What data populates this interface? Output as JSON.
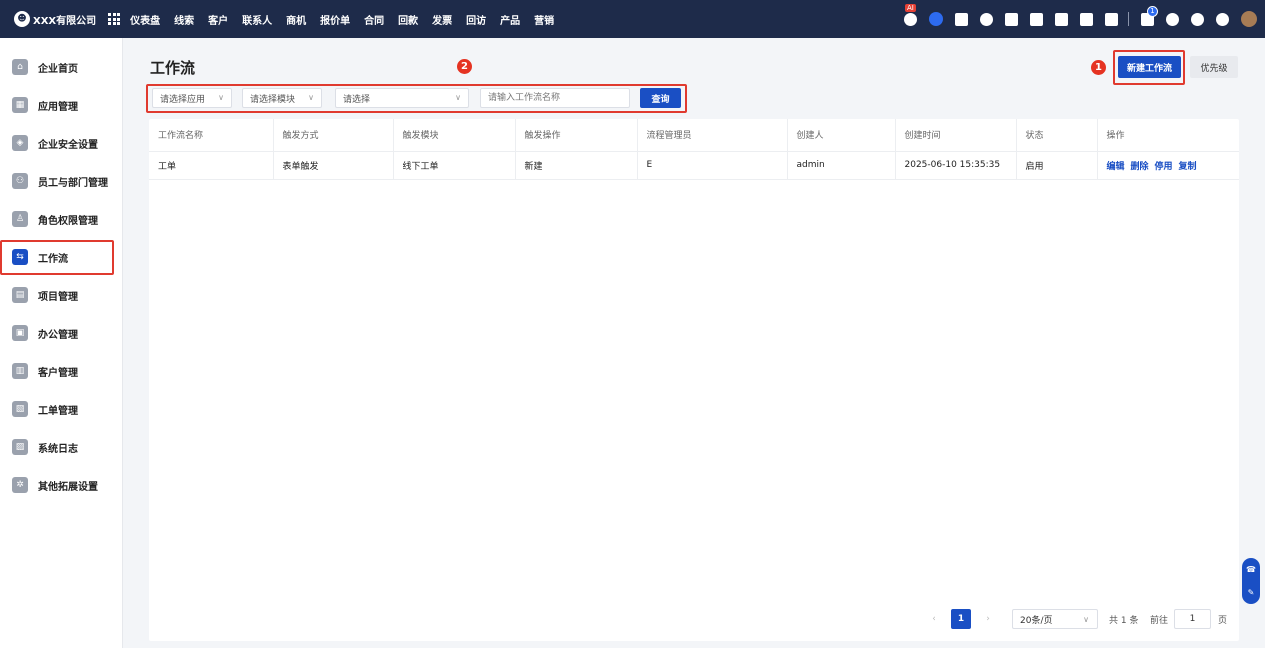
{
  "topbar": {
    "company": "XXX有限公司",
    "nav": [
      "仪表盘",
      "线索",
      "客户",
      "联系人",
      "商机",
      "报价单",
      "合同",
      "回款",
      "发票",
      "回访",
      "产品",
      "营销"
    ],
    "ai_badge": "AI",
    "notification_count": "1"
  },
  "sidebar": {
    "items": [
      {
        "label": "企业首页",
        "icon": "home-icon"
      },
      {
        "label": "应用管理",
        "icon": "apps-icon"
      },
      {
        "label": "企业安全设置",
        "icon": "shield-icon"
      },
      {
        "label": "员工与部门管理",
        "icon": "users-icon"
      },
      {
        "label": "角色权限管理",
        "icon": "role-icon"
      },
      {
        "label": "工作流",
        "icon": "workflow-icon",
        "active": true
      },
      {
        "label": "项目管理",
        "icon": "project-icon"
      },
      {
        "label": "办公管理",
        "icon": "office-icon"
      },
      {
        "label": "客户管理",
        "icon": "customer-icon"
      },
      {
        "label": "工单管理",
        "icon": "ticket-icon"
      },
      {
        "label": "系统日志",
        "icon": "log-icon"
      },
      {
        "label": "其他拓展设置",
        "icon": "settings-icon"
      }
    ]
  },
  "main": {
    "title": "工作流",
    "new_button": "新建工作流",
    "priority_button": "优先级",
    "markers": {
      "one": "1",
      "two": "2"
    },
    "filters": {
      "app_placeholder": "请选择应用",
      "module_placeholder": "请选择模块",
      "select_placeholder": "请选择",
      "name_placeholder": "请输入工作流名称",
      "query_button": "查询"
    },
    "table": {
      "columns": [
        "工作流名称",
        "触发方式",
        "触发模块",
        "触发操作",
        "流程管理员",
        "创建人",
        "创建时间",
        "状态",
        "操作"
      ],
      "rows": [
        {
          "cells": [
            "工单",
            "表单触发",
            "线下工单",
            "新建",
            "E",
            "admin",
            "2025-06-10 15:35:35",
            "启用"
          ],
          "actions": [
            "编辑",
            "删除",
            "停用",
            "复制"
          ]
        }
      ]
    },
    "pagination": {
      "current_page": "1",
      "page_size": "20条/页",
      "total": "共 1 条",
      "goto_label": "前往",
      "goto_value": "1",
      "page_unit": "页"
    }
  },
  "colors": {
    "topbar_bg": "#1e2b4a",
    "primary": "#1a4fc4",
    "highlight_red": "#e03a2f"
  }
}
